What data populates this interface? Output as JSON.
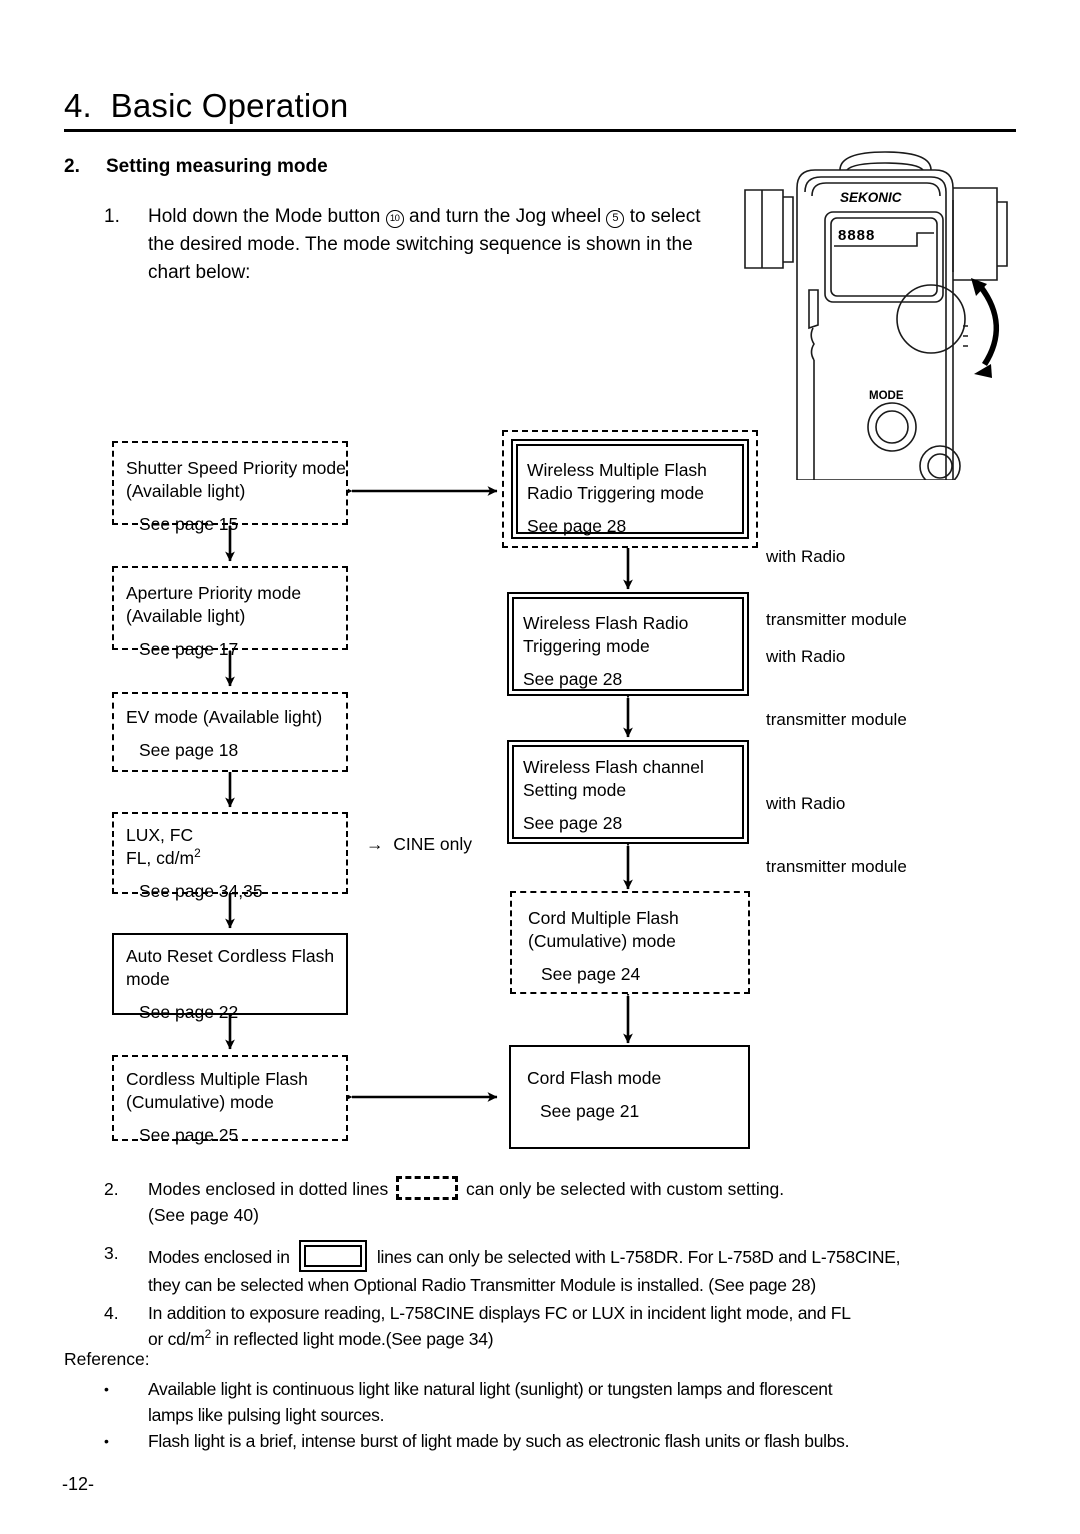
{
  "header": {
    "chapter_number": "4.",
    "chapter_title": "Basic Operation"
  },
  "section": {
    "number": "2.",
    "title": "Setting measuring mode"
  },
  "step_1": {
    "number": "1.",
    "text_part_1": "Hold down the Mode button ",
    "marker_1": "10",
    "text_part_2": " and turn the Jog wheel ",
    "marker_2": "5",
    "text_part_3": " to select the desired mode. The mode switching sequence is shown in the chart below:"
  },
  "device": {
    "brand": "SEKONIC",
    "mode_button_label": "MODE",
    "display_digits": "8888"
  },
  "flowchart": {
    "left_column": [
      {
        "id": "shutter-speed-priority",
        "style": "dashed",
        "line1": "Shutter Speed Priority mode",
        "line2": "(Available light)",
        "page": "See page 15"
      },
      {
        "id": "aperture-priority",
        "style": "dashed",
        "line1": "Aperture Priority mode",
        "line2": "(Available light)",
        "page": "See page 17"
      },
      {
        "id": "ev-mode",
        "style": "dashed",
        "line1": "EV mode (Available light)",
        "line2": "",
        "page": "See page 18"
      },
      {
        "id": "lux-fc",
        "style": "dashed",
        "line1": "LUX, FC",
        "line2": "FL, cd/m2",
        "page": "See page 34,35"
      },
      {
        "id": "auto-reset-cordless-flash",
        "style": "solid",
        "line1": "Auto Reset Cordless Flash",
        "line2": "mode",
        "page": "See page 22"
      },
      {
        "id": "cordless-multiple-flash",
        "style": "dashed",
        "line1": "Cordless Multiple Flash",
        "line2": "(Cumulative) mode",
        "page": "See page 25"
      }
    ],
    "right_column": [
      {
        "id": "wireless-multiple-flash-radio",
        "style": "double-in-dashed",
        "line1": "Wireless Multiple Flash",
        "line2": "Radio Triggering mode",
        "page": "See page 28",
        "side_note_line1": "with Radio",
        "side_note_line2": "transmitter module"
      },
      {
        "id": "wireless-flash-radio-triggering",
        "style": "double",
        "line1": "Wireless Flash Radio",
        "line2": "Triggering mode",
        "page": "See page 28",
        "side_note_line1": "with Radio",
        "side_note_line2": "transmitter module"
      },
      {
        "id": "wireless-flash-channel-setting",
        "style": "double",
        "line1": "Wireless Flash channel",
        "line2": "Setting mode",
        "page": "See page 28",
        "side_note_line1": "with Radio",
        "side_note_line2": "transmitter module"
      },
      {
        "id": "cord-multiple-flash",
        "style": "dashed",
        "line1": "Cord Multiple Flash",
        "line2": "(Cumulative) mode",
        "page": "See page 24",
        "side_note_line1": "",
        "side_note_line2": ""
      },
      {
        "id": "cord-flash-mode",
        "style": "solid",
        "line1": "Cord Flash mode",
        "line2": "",
        "page": "See page 21",
        "side_note_line1": "",
        "side_note_line2": ""
      }
    ],
    "cine_note": "→  CINE only"
  },
  "notes": {
    "note2": {
      "number": "2.",
      "before_sample": "Modes enclosed in dotted lines ",
      "after_sample": " can only be selected with custom setting.",
      "line2": "(See page 40)"
    },
    "note3": {
      "number": "3.",
      "before_sample": "Modes enclosed in ",
      "after_sample": " lines can only be selected with L-758DR. For L-758D and L-758CINE,",
      "line2": "they can be selected when Optional Radio Transmitter Module is installed. (See page 28)"
    },
    "note4": {
      "number": "4.",
      "line1": "In addition to exposure reading, L-758CINE displays FC or LUX in incident light mode, and FL",
      "line2_pre": "or cd/m",
      "line2_sup": "2",
      "line2_post": " in reflected light mode.(See page 34)"
    }
  },
  "reference": {
    "label": "Reference:",
    "bullet": "•",
    "items": [
      {
        "line1": "Available light is continuous light like natural light (sunlight) or tungsten lamps and florescent",
        "line2": "lamps like pulsing light sources."
      },
      {
        "line1": "Flash light is a brief, intense burst of light made by such as electronic flash units or flash bulbs.",
        "line2": ""
      }
    ]
  },
  "footer": {
    "page_number": "-12-"
  }
}
